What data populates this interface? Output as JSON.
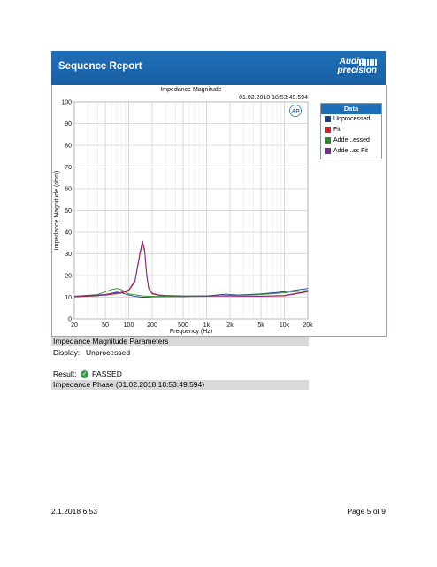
{
  "header": {
    "title": "Sequence Report",
    "logo_line1": "Audio",
    "logo_line2": "precision"
  },
  "chart": {
    "ap_badge": "AP",
    "legend_title": "Data",
    "legend": [
      {
        "name": "Unprocessed",
        "color": "#1a3f8f"
      },
      {
        "name": "Fit",
        "color": "#cc2222"
      },
      {
        "name": "Adde...essed",
        "color": "#2a8a2a"
      },
      {
        "name": "Adde...ss Fit",
        "color": "#7a2a9a"
      }
    ]
  },
  "chart_data": {
    "type": "line",
    "title": "Impedance Magnitude",
    "timestamp": "01.02.2018 18:53:49.594",
    "xlabel": "Frequency (Hz)",
    "ylabel": "Impedance Magnitude (ohm)",
    "x_scale": "log",
    "xlim": [
      20,
      20000
    ],
    "ylim": [
      0,
      100
    ],
    "x_ticks": [
      20,
      50,
      100,
      200,
      500,
      1000,
      2000,
      5000,
      10000,
      20000
    ],
    "x_tick_labels": [
      "20",
      "50",
      "100",
      "200",
      "500",
      "1k",
      "2k",
      "5k",
      "10k",
      "20k"
    ],
    "y_ticks": [
      0,
      10,
      20,
      30,
      40,
      50,
      60,
      70,
      80,
      90,
      100
    ],
    "grid": true,
    "series": [
      {
        "name": "Unprocessed",
        "color": "#1a3f8f",
        "x": [
          20,
          40,
          60,
          70,
          80,
          100,
          120,
          140,
          150,
          160,
          180,
          200,
          300,
          500,
          1000,
          1800,
          2000,
          2500,
          5000,
          10000,
          20000
        ],
        "y": [
          10.2,
          10.6,
          11.8,
          12.3,
          12.0,
          11.0,
          10.4,
          10.1,
          10.0,
          10.0,
          10.1,
          10.2,
          10.3,
          10.3,
          10.6,
          11.4,
          11.2,
          11.0,
          11.5,
          12.5,
          14.0
        ]
      },
      {
        "name": "Fit",
        "color": "#cc2222",
        "x": [
          20,
          50,
          80,
          100,
          120,
          140,
          150,
          160,
          170,
          180,
          200,
          250,
          300,
          500,
          1000,
          2000,
          5000,
          10000,
          20000
        ],
        "y": [
          10.3,
          10.9,
          11.8,
          13.0,
          17.0,
          30.0,
          35.0,
          31.0,
          20.0,
          14.0,
          11.5,
          10.8,
          10.6,
          10.5,
          10.5,
          10.5,
          10.4,
          10.6,
          12.5
        ]
      },
      {
        "name": "Adde...essed",
        "color": "#2a8a2a",
        "x": [
          20,
          40,
          60,
          70,
          80,
          100,
          150,
          200,
          500,
          1000,
          2000,
          5000,
          10000,
          20000
        ],
        "y": [
          10.4,
          11.2,
          13.5,
          14.0,
          13.5,
          11.5,
          10.6,
          10.4,
          10.3,
          10.4,
          10.8,
          11.2,
          12.0,
          13.2
        ]
      },
      {
        "name": "Adde...ss Fit",
        "color": "#7a2a9a",
        "x": [
          20,
          50,
          80,
          100,
          120,
          140,
          150,
          160,
          170,
          180,
          200,
          250,
          300,
          500,
          1000,
          2000,
          5000,
          10000,
          20000
        ],
        "y": [
          10.5,
          11.2,
          12.2,
          13.4,
          17.5,
          31.0,
          36.0,
          32.0,
          21.0,
          14.5,
          11.8,
          11.0,
          10.8,
          10.6,
          10.6,
          10.6,
          10.5,
          10.8,
          12.8
        ]
      }
    ]
  },
  "params": {
    "section_title": "Impedance Magnitude Parameters",
    "display_label": "Display:",
    "display_value": "Unprocessed",
    "result_label": "Result:",
    "result_value": "PASSED",
    "next_section": "Impedance Phase (01.02.2018 18:53:49.594)"
  },
  "footer": {
    "date": "2.1.2018 6:53",
    "page": "Page 5 of 9"
  }
}
